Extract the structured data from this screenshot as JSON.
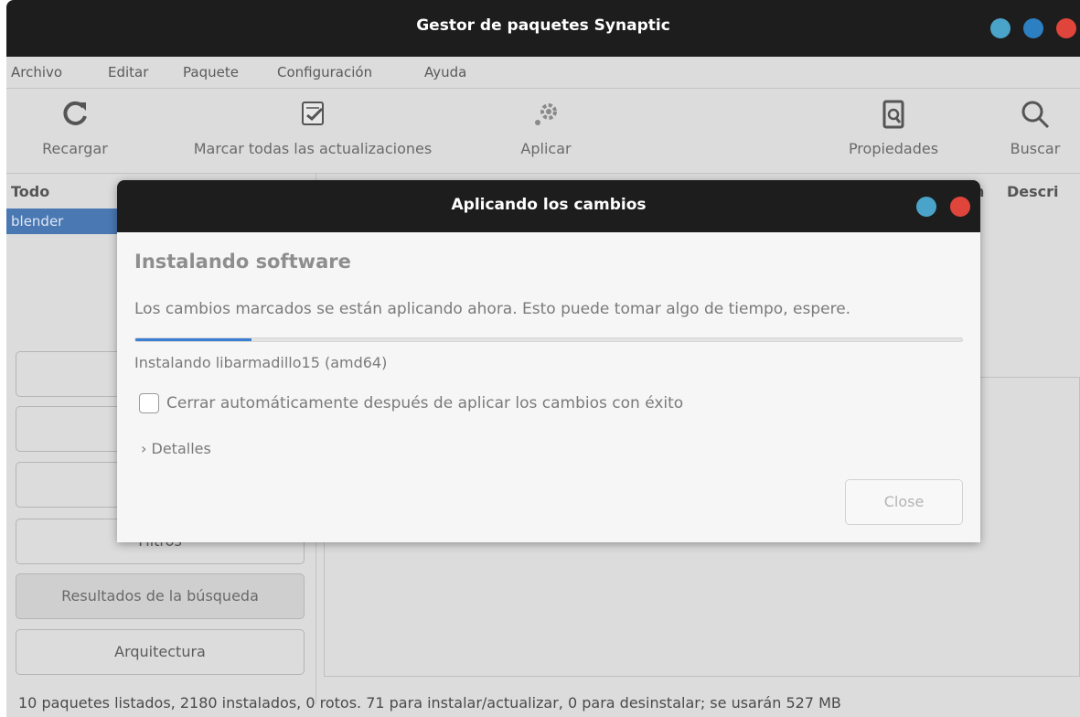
{
  "window": {
    "title": "Gestor de paquetes Synaptic",
    "btn_colors": [
      "#4aa3c8",
      "#2c7fc1",
      "#e0453c"
    ]
  },
  "menu": [
    "Archivo",
    "Editar",
    "Paquete",
    "Configuración",
    "Ayuda"
  ],
  "toolbar": {
    "reload": "Recargar",
    "mark_all": "Marcar todas las actualizaciones",
    "apply": "Aplicar",
    "properties": "Propiedades",
    "search": "Buscar"
  },
  "list": {
    "filter_header": "Todo",
    "selected_item": "blender",
    "col_partial": "n",
    "col_description": "Descri"
  },
  "sidebar": {
    "filters_label": "Filtros",
    "search_results": "Resultados de la búsqueda",
    "architecture": "Arquitectura"
  },
  "status": "10 paquetes listados, 2180 instalados, 0 rotos. 71 para instalar/actualizar, 0 para desinstalar; se usarán 527 MB",
  "dialog": {
    "title": "Aplicando los cambios",
    "heading": "Instalando software",
    "message": "Los cambios marcados se están aplicando ahora. Esto puede tomar algo de tiempo, espere.",
    "progress_percent": 14,
    "status_text": "Instalando libarmadillo15 (amd64)",
    "auto_close_label": "Cerrar automáticamente después de aplicar los cambios con éxito",
    "auto_close_checked": false,
    "details_label": "Detalles",
    "close_label": "Close",
    "btn_colors": [
      "#4aa3c8",
      "#e0453c"
    ]
  }
}
